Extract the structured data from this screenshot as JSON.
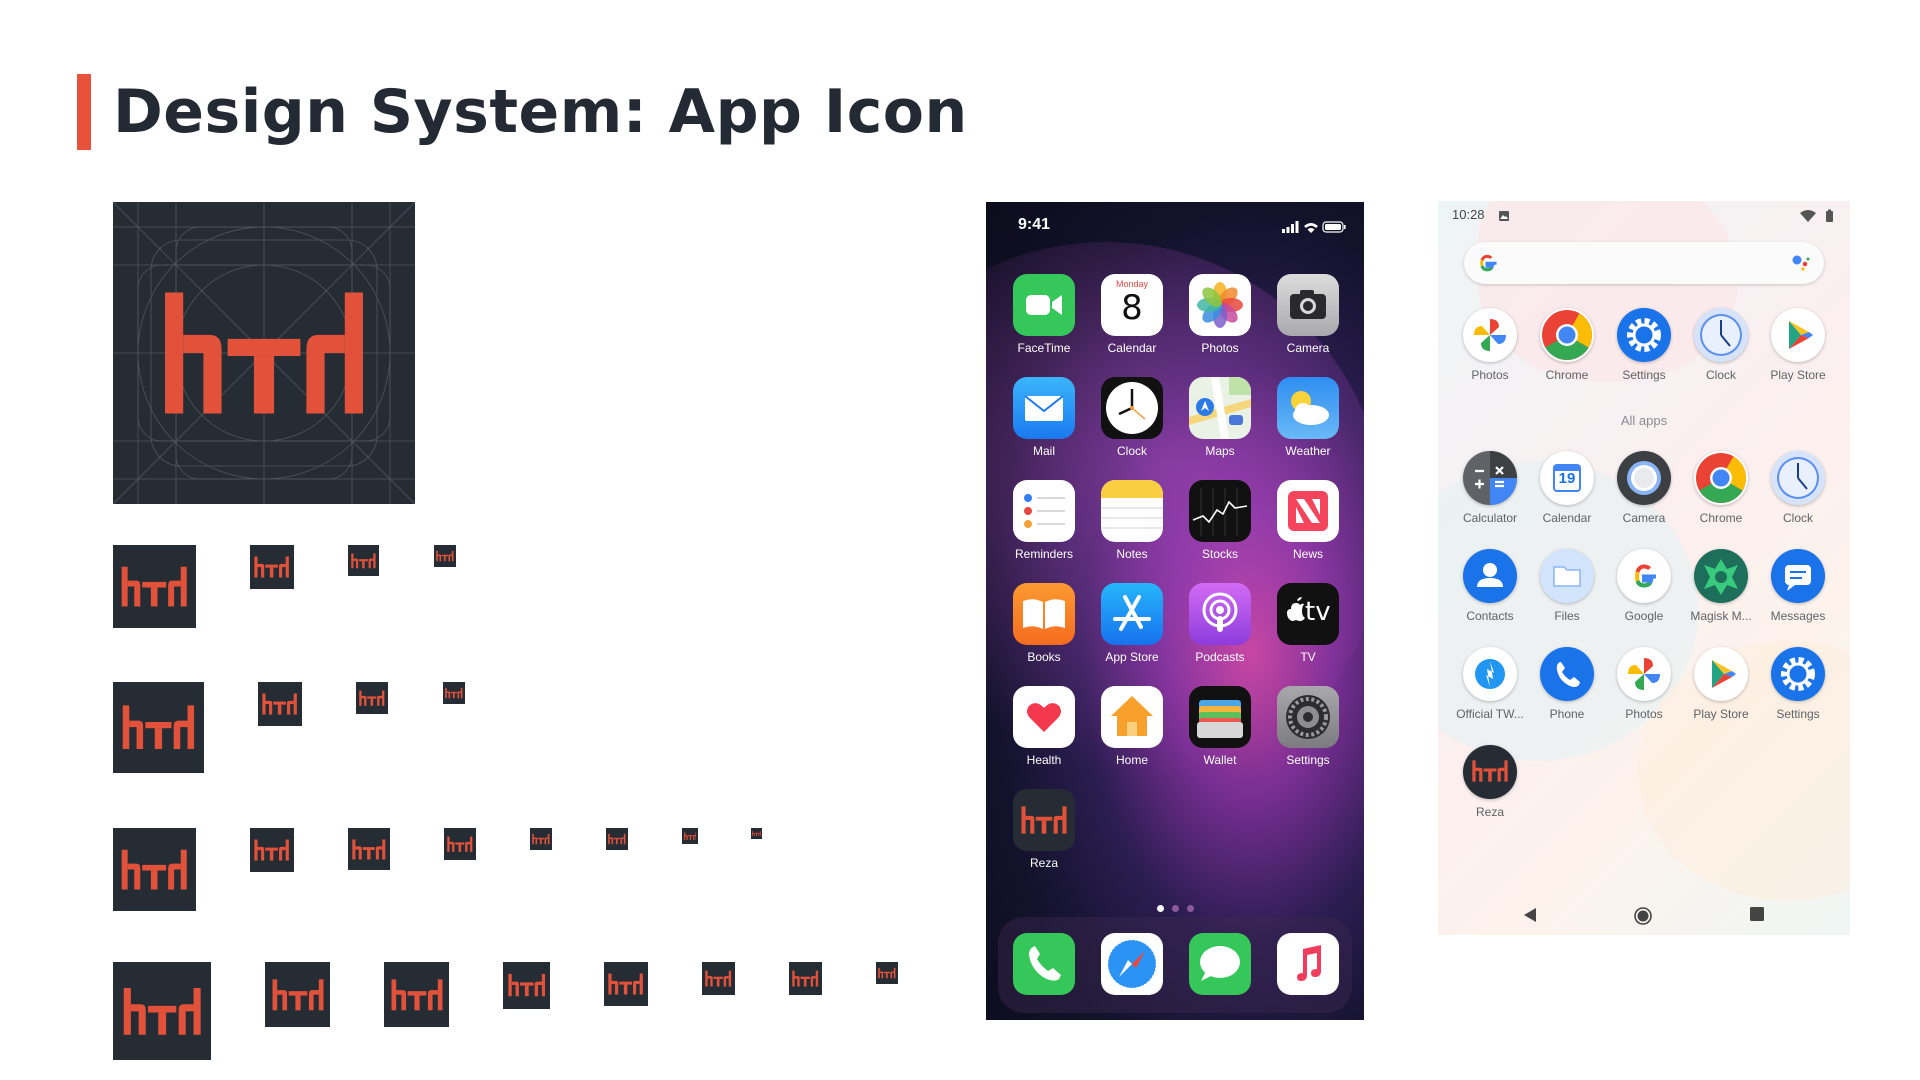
{
  "page": {
    "title": "Design System: App Icon",
    "accent_color": "#e8523a",
    "icon_bg": "#262c34"
  },
  "ios": {
    "time": "9:41",
    "apps": [
      {
        "label": "FaceTime",
        "icon": "facetime-icon"
      },
      {
        "label": "Calendar",
        "icon": "calendar-icon",
        "weekday": "Monday",
        "day": "8"
      },
      {
        "label": "Photos",
        "icon": "photos-icon"
      },
      {
        "label": "Camera",
        "icon": "camera-icon"
      },
      {
        "label": "Mail",
        "icon": "mail-icon"
      },
      {
        "label": "Clock",
        "icon": "clock-icon"
      },
      {
        "label": "Maps",
        "icon": "maps-icon"
      },
      {
        "label": "Weather",
        "icon": "weather-icon"
      },
      {
        "label": "Reminders",
        "icon": "reminders-icon"
      },
      {
        "label": "Notes",
        "icon": "notes-icon"
      },
      {
        "label": "Stocks",
        "icon": "stocks-icon"
      },
      {
        "label": "News",
        "icon": "news-icon"
      },
      {
        "label": "Books",
        "icon": "books-icon"
      },
      {
        "label": "App Store",
        "icon": "app-store-icon"
      },
      {
        "label": "Podcasts",
        "icon": "podcasts-icon"
      },
      {
        "label": "TV",
        "icon": "tv-icon",
        "glyph": "tv"
      },
      {
        "label": "Health",
        "icon": "health-icon"
      },
      {
        "label": "Home",
        "icon": "home-icon"
      },
      {
        "label": "Wallet",
        "icon": "wallet-icon"
      },
      {
        "label": "Settings",
        "icon": "settings-icon"
      },
      {
        "label": "Reza",
        "icon": "reza-icon"
      }
    ],
    "dock": [
      {
        "icon": "phone-icon"
      },
      {
        "icon": "safari-icon"
      },
      {
        "icon": "messages-icon"
      },
      {
        "icon": "music-icon"
      }
    ]
  },
  "android": {
    "time": "10:28",
    "favorites": [
      {
        "label": "Photos",
        "icon": "photos-icon"
      },
      {
        "label": "Chrome",
        "icon": "chrome-icon"
      },
      {
        "label": "Settings",
        "icon": "settings-icon"
      },
      {
        "label": "Clock",
        "icon": "clock-icon"
      },
      {
        "label": "Play Store",
        "icon": "play-store-icon"
      }
    ],
    "all_apps_label": "All apps",
    "apps": [
      {
        "label": "Calculator",
        "icon": "calculator-icon"
      },
      {
        "label": "Calendar",
        "icon": "calendar-icon",
        "day": "19"
      },
      {
        "label": "Camera",
        "icon": "camera-icon"
      },
      {
        "label": "Chrome",
        "icon": "chrome-icon"
      },
      {
        "label": "Clock",
        "icon": "clock-icon"
      },
      {
        "label": "Contacts",
        "icon": "contacts-icon"
      },
      {
        "label": "Files",
        "icon": "files-icon"
      },
      {
        "label": "Google",
        "icon": "google-icon"
      },
      {
        "label": "Magisk M...",
        "icon": "magisk-icon"
      },
      {
        "label": "Messages",
        "icon": "messages-icon"
      },
      {
        "label": "Official TW...",
        "icon": "official-tw-icon"
      },
      {
        "label": "Phone",
        "icon": "phone-icon"
      },
      {
        "label": "Photos",
        "icon": "photos-icon"
      },
      {
        "label": "Play Store",
        "icon": "play-store-icon"
      },
      {
        "label": "Settings",
        "icon": "settings-icon"
      },
      {
        "label": "Reza",
        "icon": "reza-icon"
      }
    ]
  }
}
